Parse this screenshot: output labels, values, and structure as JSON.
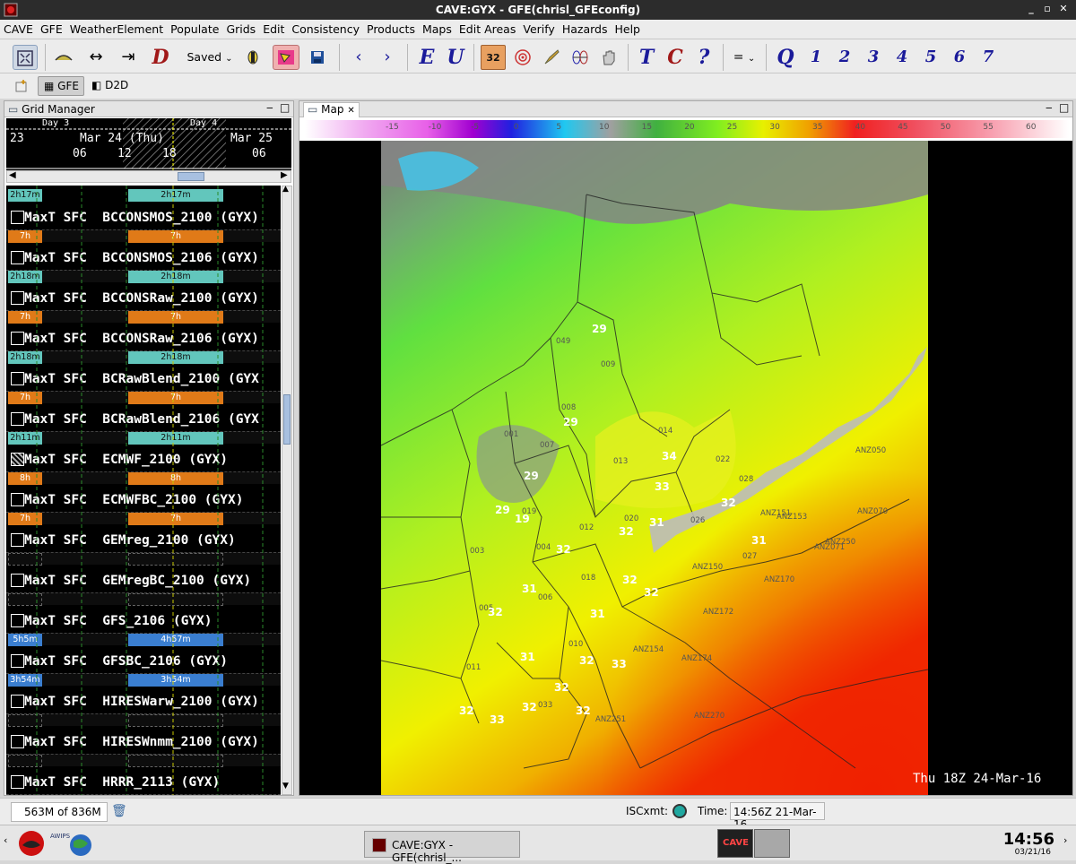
{
  "window": {
    "title": "CAVE:GYX - GFE(chrisl_GFEconfig)",
    "min": "_",
    "max": "▫",
    "close": "✕"
  },
  "menu": [
    "CAVE",
    "GFE",
    "WeatherElement",
    "Populate",
    "Grids",
    "Edit",
    "Consistency",
    "Products",
    "Maps",
    "Edit Areas",
    "Verify",
    "Hazards",
    "Help"
  ],
  "toolbar": {
    "saved_label": "Saved",
    "saved_caret": "⌄",
    "d_label": "D",
    "e_label": "E",
    "u_label": "U",
    "t_label": "T",
    "c_label": "C",
    "q_mark": "?",
    "eq_label": "=",
    "q_label": "Q",
    "numbers": [
      "1",
      "2",
      "3",
      "4",
      "5",
      "6",
      "7"
    ],
    "badge_32": "32"
  },
  "perspectives": {
    "gfe": "GFE",
    "d2d": "D2D"
  },
  "grid_manager": {
    "tab_label": "Grid Manager",
    "day3": "Day 3",
    "day4": "Day 4",
    "date_23": "23",
    "date_24": "Mar 24 (Thu)",
    "date_25": "Mar 25",
    "hours": [
      "06",
      "12",
      "18",
      "06"
    ],
    "first_bar": "2h17m",
    "rows": [
      {
        "label": "MaxT SFC  BCCONSMOS_2100 (GYX)",
        "bars": [
          {
            "t": "7h",
            "c": "orange"
          },
          {
            "t": "7h",
            "c": "orange"
          }
        ]
      },
      {
        "label": "MaxT SFC  BCCONSMOS_2106 (GYX)",
        "bars": [
          {
            "t": "2h18m",
            "c": "teal"
          },
          {
            "t": "2h18m",
            "c": "teal"
          }
        ]
      },
      {
        "label": "MaxT SFC  BCCONSRaw_2100 (GYX)",
        "bars": [
          {
            "t": "7h",
            "c": "orange"
          },
          {
            "t": "7h",
            "c": "orange"
          }
        ]
      },
      {
        "label": "MaxT SFC  BCCONSRaw_2106 (GYX)",
        "bars": [
          {
            "t": "2h18m",
            "c": "teal"
          },
          {
            "t": "2h18m",
            "c": "teal"
          }
        ]
      },
      {
        "label": "MaxT SFC  BCRawBlend_2100 (GYX",
        "bars": [
          {
            "t": "7h",
            "c": "orange"
          },
          {
            "t": "7h",
            "c": "orange"
          }
        ]
      },
      {
        "label": "MaxT SFC  BCRawBlend_2106 (GYX",
        "bars": [
          {
            "t": "2h11m",
            "c": "teal"
          },
          {
            "t": "2h11m",
            "c": "teal"
          }
        ]
      },
      {
        "label": "MaxT SFC  ECMWF_2100 (GYX)",
        "bars": [
          {
            "t": "8h",
            "c": "orange"
          },
          {
            "t": "8h",
            "c": "orange"
          }
        ]
      },
      {
        "label": "MaxT SFC  ECMWFBC_2100 (GYX)",
        "bars": [
          {
            "t": "7h",
            "c": "orange"
          },
          {
            "t": "7h",
            "c": "orange"
          }
        ]
      },
      {
        "label": "MaxT SFC  GEMreg_2100 (GYX)",
        "bars": [
          {
            "t": "",
            "c": "empty"
          },
          {
            "t": "",
            "c": "empty"
          }
        ]
      },
      {
        "label": "MaxT SFC  GEMregBC_2100 (GYX)",
        "bars": [
          {
            "t": "",
            "c": "empty"
          },
          {
            "t": "",
            "c": "empty"
          }
        ]
      },
      {
        "label": "MaxT SFC  GFS_2106 (GYX)",
        "bars": [
          {
            "t": "5h5m",
            "c": "blue"
          },
          {
            "t": "4h57m",
            "c": "blue"
          }
        ]
      },
      {
        "label": "MaxT SFC  GFSBC_2106 (GYX)",
        "bars": [
          {
            "t": "3h54m",
            "c": "blue"
          },
          {
            "t": "3h54m",
            "c": "blue"
          }
        ]
      },
      {
        "label": "MaxT SFC  HIRESWarw_2100 (GYX)",
        "bars": [
          {
            "t": "",
            "c": "empty"
          },
          {
            "t": "",
            "c": "empty"
          }
        ]
      },
      {
        "label": "MaxT SFC  HIRESWnmm_2100 (GYX)",
        "bars": [
          {
            "t": "",
            "c": "empty"
          },
          {
            "t": "",
            "c": "empty"
          }
        ]
      },
      {
        "label": "MaxT SFC  HRRR_2113 (GYX)",
        "bars": []
      }
    ]
  },
  "map": {
    "tab_label": "Map",
    "colorbar_ticks": [
      "-15",
      "-10",
      "-5",
      "0",
      "5",
      "10",
      "15",
      "20",
      "25",
      "30",
      "35",
      "40",
      "45",
      "50",
      "55",
      "60"
    ],
    "timestamp": "Thu 18Z 24-Mar-16",
    "zone_labels": [
      "001",
      "003",
      "004",
      "005",
      "006",
      "007",
      "008",
      "009",
      "010",
      "011",
      "012",
      "013",
      "014",
      "018",
      "019",
      "020",
      "022",
      "026",
      "027",
      "028",
      "033",
      "049",
      "ANZ050",
      "ANZ070",
      "ANZ071",
      "ANZ150",
      "ANZ151",
      "ANZ153",
      "ANZ154",
      "ANZ170",
      "ANZ172",
      "ANZ174",
      "ANZ250",
      "ANZ251",
      "ANZ270"
    ],
    "values": [
      "29",
      "29",
      "29",
      "34",
      "33",
      "29",
      "19",
      "32",
      "32",
      "31",
      "32",
      "31",
      "32",
      "32",
      "31",
      "32",
      "31",
      "32",
      "32",
      "32",
      "33",
      "32",
      "32",
      "33",
      "31"
    ]
  },
  "status": {
    "memory": "563M of 836M",
    "iscxmt_label": "ISCxmt:",
    "time_label": "Time:",
    "time_value": "14:56Z 21-Mar-16"
  },
  "taskbar": {
    "task_label": "CAVE:GYX - GFE(chrisl_...",
    "clock": "14:56",
    "date": "03/21/16",
    "cave_logo": "CAVE"
  }
}
